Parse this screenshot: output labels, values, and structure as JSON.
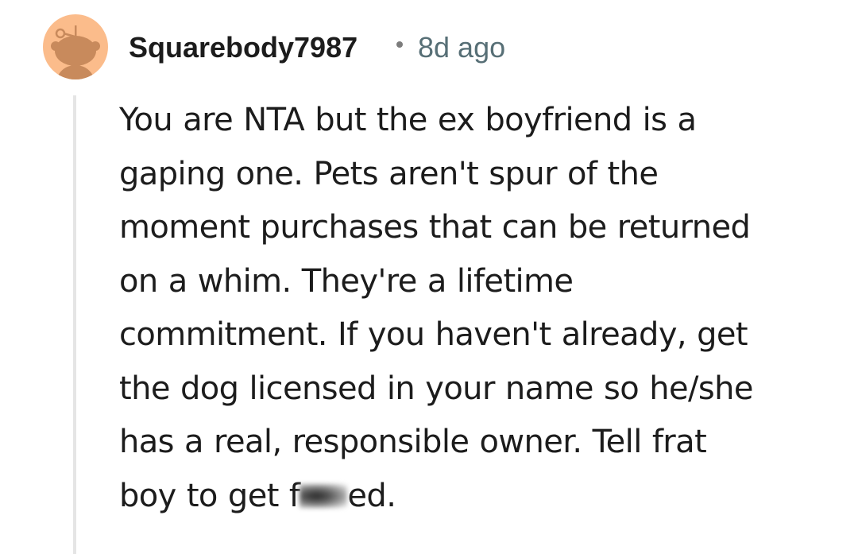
{
  "comment": {
    "author": "Squarebody7987",
    "separator": "•",
    "timestamp": "8d ago",
    "body_lines": [
      "You are NTA but the ex boyfriend is a",
      "gaping one. Pets aren't spur of the",
      "moment purchases that can be returned",
      "on a whim. They're a lifetime",
      "commitment. If you haven't already, get",
      "the dog licensed in your name so he/she",
      "has a real, responsible owner. Tell frat"
    ],
    "last_line": {
      "before_censor": "boy to get f",
      "after_censor": "ed."
    }
  },
  "colors": {
    "avatar_bg": "#fbbc8b",
    "avatar_figure": "#c88a5c",
    "text": "#1c1c1c",
    "meta": "#576f76",
    "thread_line": "#e5e5e5"
  },
  "icons": {
    "avatar": "snoo-avatar-icon",
    "censor": "blurred-censor-mark"
  }
}
